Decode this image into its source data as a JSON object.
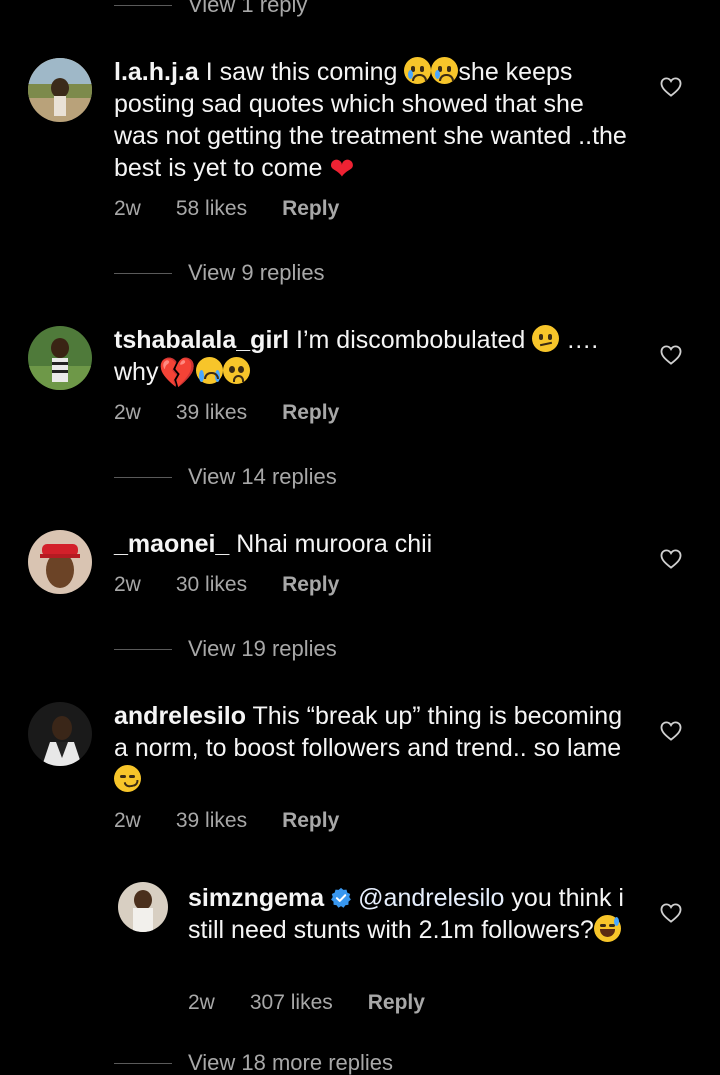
{
  "top_view_replies": "View 1 reply",
  "comments": [
    {
      "username": "l.a.h.j.a",
      "text_before": "I saw this coming",
      "text_after": "she keeps posting sad quotes which showed that she was not getting the treatment she wanted ..the best is yet to come",
      "time": "2w",
      "likes": "58 likes",
      "reply": "Reply",
      "view_replies": "View 9 replies"
    },
    {
      "username": "tshabalala_girl",
      "text_before": "I’m discombobulated",
      "text_mid": "….",
      "text_after": "why",
      "time": "2w",
      "likes": "39 likes",
      "reply": "Reply",
      "view_replies": "View 14 replies"
    },
    {
      "username": "_maonei_",
      "text": "Nhai muroora chii",
      "time": "2w",
      "likes": "30 likes",
      "reply": "Reply",
      "view_replies": "View 19 replies"
    },
    {
      "username": "andrelesilo",
      "text": "This “break up” thing is becoming a norm, to boost followers and trend.. so lame",
      "time": "2w",
      "likes": "39 likes",
      "reply": "Reply"
    }
  ],
  "reply": {
    "username": "simzngema",
    "mention": "@andrelesilo",
    "text": "you think i still need stunts with 2.1m followers?",
    "time": "2w",
    "likes": "307 likes",
    "reply": "Reply"
  },
  "bottom_view_replies": "View 18 more replies",
  "colors": {
    "background": "#000000",
    "text": "#f5f5f5",
    "secondary": "#a8a8a8",
    "verified": "#3897f0",
    "heart_emoji": "#ee2233"
  },
  "icons": [
    "heart-outline-icon",
    "verified-badge-icon"
  ]
}
